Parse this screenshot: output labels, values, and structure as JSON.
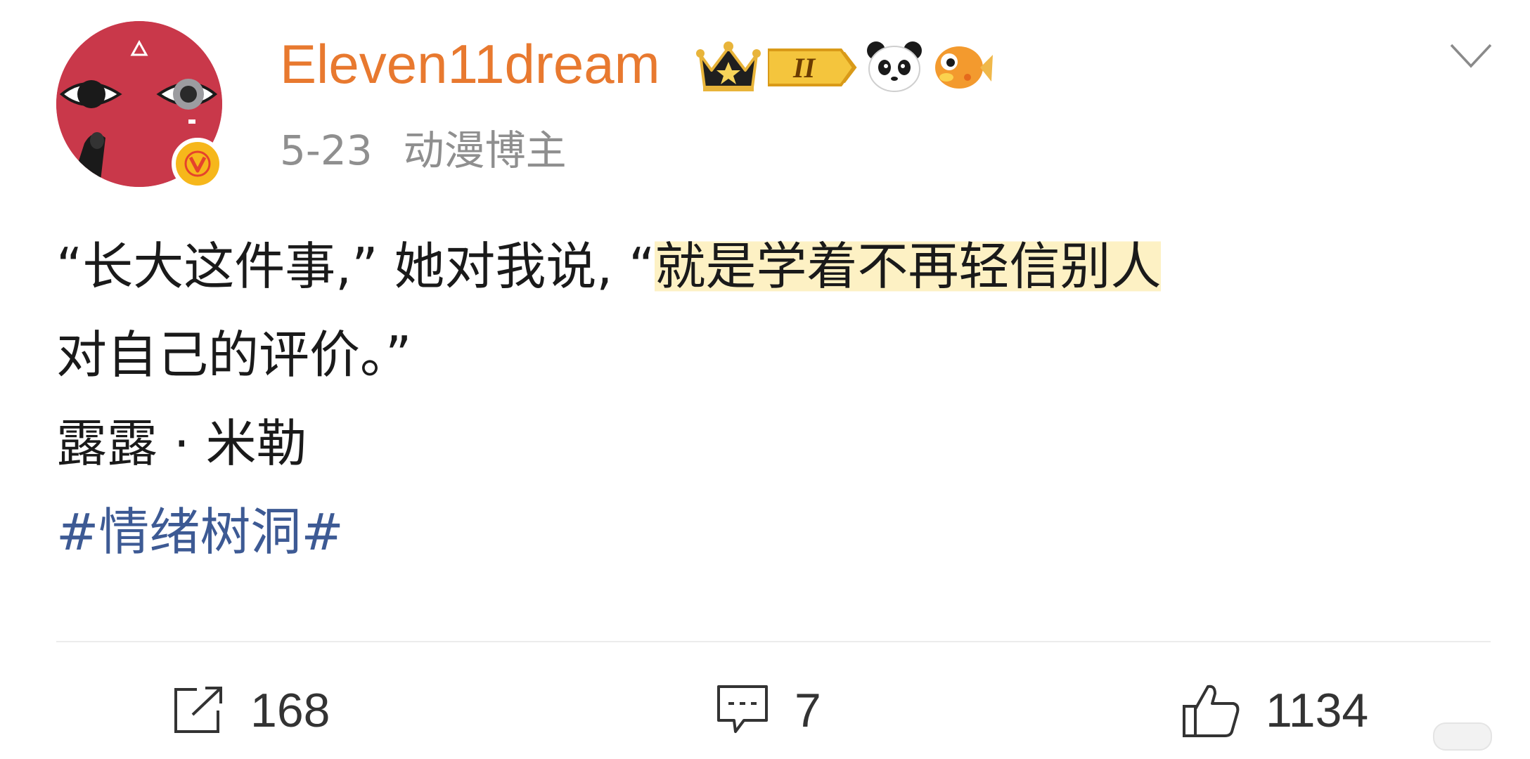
{
  "post": {
    "author": {
      "username": "Eleven11dream",
      "verified_badge": "V",
      "level_badge": "II",
      "badge_icons": [
        "crown-icon",
        "level-badge-icon",
        "panda-emoji-icon",
        "fish-emoji-icon"
      ],
      "avatar_icon": "red-face-avatar-icon"
    },
    "date": "5-23",
    "identity": "动漫博主",
    "content": {
      "line1_plain": "“长大这件事,”  她对我说,  “",
      "line1_highlight": "就是学着不再轻信别人",
      "line2": "对自己的评价。”",
      "line3": "露露 · 米勒",
      "hashtag": "#情绪树洞#"
    },
    "actions": {
      "share_count": "168",
      "comment_count": "7",
      "like_count": "1134"
    },
    "colors": {
      "username": "#e8792f",
      "highlight": "#fdf1c4",
      "hashtag": "#3d5a94",
      "avatar": "#c9384a",
      "verified": "#f6b71b"
    }
  }
}
